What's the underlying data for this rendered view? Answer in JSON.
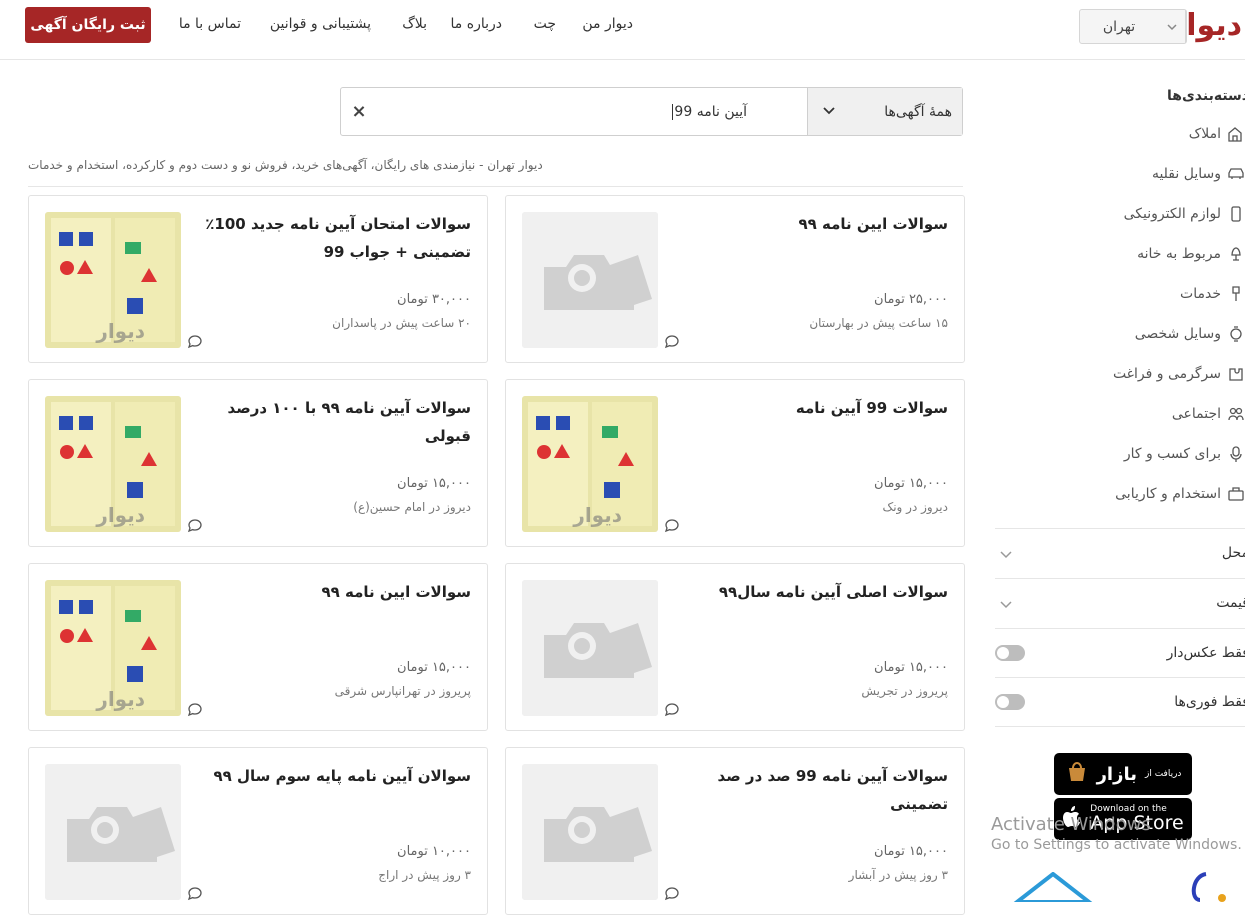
{
  "header": {
    "logo": "دیوار",
    "city": "تهران",
    "nav": [
      "دیوار من",
      "چت",
      "درباره ما",
      "بلاگ",
      "پشتیبانی و قوانین",
      "تماس با ما"
    ],
    "post_button": "ثبت رایگان آگهی"
  },
  "search": {
    "category": "همهٔ آگهی‌ها",
    "query": "آیین نامه 99",
    "clear": "×"
  },
  "breadcrumb": "دیوار تهران - نیازمندی های رایگان، آگهی‌های خرید، فروش نو و دست دوم و کارکرده، استخدام و خدمات",
  "listings": [
    {
      "title": "سوالات ایین نامه ۹۹",
      "price": "۲۵,۰۰۰ تومان",
      "meta": "۱۵ ساعت پیش در بهارستان",
      "photo": false
    },
    {
      "title": "سوالات امتحان آیین نامه جدید 100٪ تضمینی + جواب 99",
      "price": "۳۰,۰۰۰ تومان",
      "meta": "۲۰ ساعت پیش در پاسداران",
      "photo": true
    },
    {
      "title": "سوالات 99 آیین نامه",
      "price": "۱۵,۰۰۰ تومان",
      "meta": "دیروز در ونک",
      "photo": true
    },
    {
      "title": "سوالات آیین نامه ۹۹ با ۱۰۰ درصد قبولی",
      "price": "۱۵,۰۰۰ تومان",
      "meta": "دیروز در امام حسین(ع)",
      "photo": true
    },
    {
      "title": "سوالات اصلی آیین نامه سال۹۹",
      "price": "۱۵,۰۰۰ تومان",
      "meta": "پریروز در تجریش",
      "photo": false
    },
    {
      "title": "سوالات ایین نامه ۹۹",
      "price": "۱۵,۰۰۰ تومان",
      "meta": "پریروز در تهرانپارس شرقی",
      "photo": true
    },
    {
      "title": "سوالات آیین نامه 99 صد در صد تضمینی",
      "price": "۱۵,۰۰۰ تومان",
      "meta": "۳ روز پیش در آبشار",
      "photo": false
    },
    {
      "title": "سوالان آیین نامه پایه سوم سال ۹۹",
      "price": "۱۰,۰۰۰ تومان",
      "meta": "۳ روز پیش در اراج",
      "photo": false
    }
  ],
  "sidebar": {
    "heading": "دسته‌بندی‌ها",
    "categories": [
      {
        "label": "املاک",
        "icon": "building-icon"
      },
      {
        "label": "وسایل نقلیه",
        "icon": "car-icon"
      },
      {
        "label": "لوازم الکترونیکی",
        "icon": "phone-icon"
      },
      {
        "label": "مربوط به خانه",
        "icon": "lamp-icon"
      },
      {
        "label": "خدمات",
        "icon": "brush-icon"
      },
      {
        "label": "وسایل شخصی",
        "icon": "watch-icon"
      },
      {
        "label": "سرگرمی و فراغت",
        "icon": "puzzle-icon"
      },
      {
        "label": "اجتماعی",
        "icon": "people-icon"
      },
      {
        "label": "برای کسب و کار",
        "icon": "microphone-icon"
      },
      {
        "label": "استخدام و کاریابی",
        "icon": "briefcase-icon"
      }
    ],
    "filters": {
      "location": "محل",
      "price": "قیمت",
      "photo_only": "فقط عکس‌دار",
      "urgent_only": "فقط فوری‌ها"
    },
    "bazaar": {
      "small": "دریافت از",
      "big": "بازار"
    },
    "appstore": {
      "small": "Download on the",
      "big": "App Store"
    }
  },
  "watermark": {
    "line1": "Activate Windows",
    "line2": "Go to Settings to activate Windows."
  }
}
